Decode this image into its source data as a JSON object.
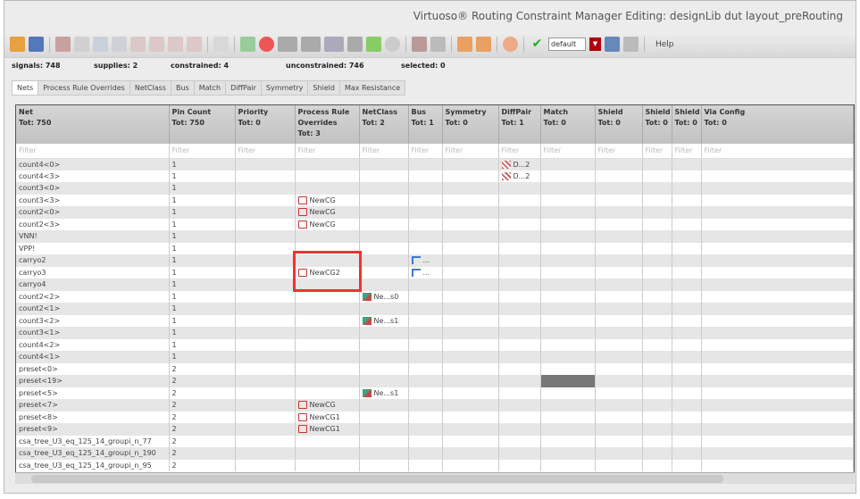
{
  "title": "Virtuoso® Routing Constraint Manager Editing: designLib dut layout_preRouting",
  "toolbar": {
    "constraint_set": "default",
    "help": "Help"
  },
  "stats": {
    "signals": "signals: 748",
    "supplies": "supplies: 2",
    "constrained": "constrained: 4",
    "unconstrained": "unconstrained: 746",
    "selected": "selected: 0"
  },
  "tabs": [
    "Nets",
    "Process Rule Overrides",
    "NetClass",
    "Bus",
    "Match",
    "DiffPair",
    "Symmetry",
    "Shield",
    "Max Resistance"
  ],
  "columns": [
    {
      "name": "Net",
      "tot": "Tot: 750"
    },
    {
      "name": "Pin Count",
      "tot": "Tot: 750"
    },
    {
      "name": "Priority",
      "tot": "Tot: 0"
    },
    {
      "name": "Process Rule Overrides",
      "tot": "Tot: 3"
    },
    {
      "name": "NetClass",
      "tot": "Tot: 2"
    },
    {
      "name": "Bus",
      "tot": "Tot: 1"
    },
    {
      "name": "Symmetry",
      "tot": "Tot: 0"
    },
    {
      "name": "DiffPair",
      "tot": "Tot: 1"
    },
    {
      "name": "Match",
      "tot": "Tot: 0"
    },
    {
      "name": "Shield",
      "tot": "Tot: 0"
    },
    {
      "name": "Shield",
      "tot": "Tot: 0"
    },
    {
      "name": "Shield",
      "tot": "Tot: 0"
    },
    {
      "name": "Via Config",
      "tot": "Tot: 0"
    }
  ],
  "filter_placeholder": "Filter",
  "rows": [
    {
      "net": "count4<0>",
      "pins": "1",
      "dp": "D...2"
    },
    {
      "net": "count4<3>",
      "pins": "1",
      "dp": "D...2"
    },
    {
      "net": "count3<0>",
      "pins": "1"
    },
    {
      "net": "count3<3>",
      "pins": "1",
      "pro": "NewCG"
    },
    {
      "net": "count2<0>",
      "pins": "1",
      "pro": "NewCG"
    },
    {
      "net": "count2<3>",
      "pins": "1",
      "pro": "NewCG"
    },
    {
      "net": "VNN!",
      "pins": "1"
    },
    {
      "net": "VPP!",
      "pins": "1"
    },
    {
      "net": "carryo2",
      "pins": "1",
      "bus": "..."
    },
    {
      "net": "carryo3",
      "pins": "1",
      "pro": "NewCG2",
      "bus": "..."
    },
    {
      "net": "carryo4",
      "pins": "1"
    },
    {
      "net": "count2<2>",
      "pins": "1",
      "nc": "Ne...s0"
    },
    {
      "net": "count2<1>",
      "pins": "1"
    },
    {
      "net": "count3<2>",
      "pins": "1",
      "nc": "Ne...s1"
    },
    {
      "net": "count3<1>",
      "pins": "1"
    },
    {
      "net": "count4<2>",
      "pins": "1"
    },
    {
      "net": "count4<1>",
      "pins": "1"
    },
    {
      "net": "preset<0>",
      "pins": "2"
    },
    {
      "net": "preset<19>",
      "pins": "2",
      "match_hl": true
    },
    {
      "net": "preset<5>",
      "pins": "2",
      "nc": "Ne...s1"
    },
    {
      "net": "preset<7>",
      "pins": "2",
      "pro": "NewCG"
    },
    {
      "net": "preset<8>",
      "pins": "2",
      "pro": "NewCG1"
    },
    {
      "net": "preset<9>",
      "pins": "2",
      "pro": "NewCG1"
    },
    {
      "net": "csa_tree_U3_eq_125_14_groupi_n_77",
      "pins": "2"
    },
    {
      "net": "csa_tree_U3_eq_125_14_groupi_n_190",
      "pins": "2"
    },
    {
      "net": "csa_tree_U3_eq_125_14_groupi_n_95",
      "pins": "2"
    }
  ]
}
